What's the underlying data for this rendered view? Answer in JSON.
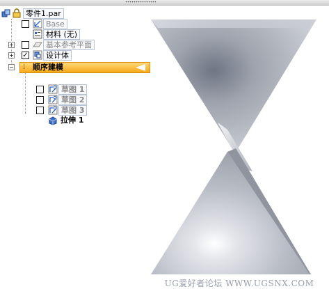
{
  "tree": {
    "root_label": "零件1.par",
    "items": [
      {
        "label": "Base",
        "checked": false
      },
      {
        "label": "材料 (无)"
      },
      {
        "label": "基本参考平面",
        "checked": false,
        "expander": "+"
      },
      {
        "label": "设计体",
        "checked": true,
        "expander": "+"
      },
      {
        "label": "顺序建模",
        "expander": "−",
        "active": true
      },
      {
        "label": "草图 1",
        "checked": false
      },
      {
        "label": "草图 2",
        "checked": false
      },
      {
        "label": "草图 3",
        "checked": false
      },
      {
        "label": "拉伸 1"
      }
    ]
  },
  "viewport": {
    "watermark": "UG爱好者论坛 WWW.UGSNX.COM"
  },
  "colors": {
    "active_bar": "#f6a81a",
    "model_body": "#c9cdd6"
  }
}
